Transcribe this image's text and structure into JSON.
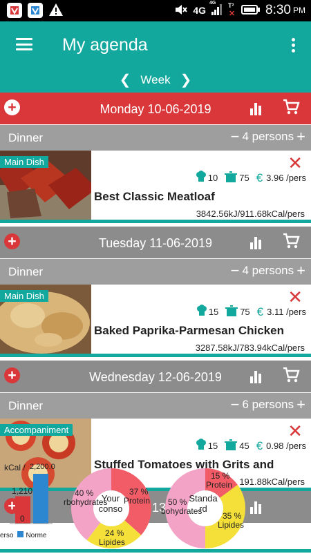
{
  "status_bar": {
    "time": "8:30",
    "ampm": "PM",
    "network": "4G",
    "network_small": "4G",
    "signal_extra": "T²"
  },
  "app_bar": {
    "title": "My agenda",
    "week_label": "Week"
  },
  "days": [
    {
      "date": "Monday 10-06-2019",
      "meal": "Dinner",
      "persons": "4 persons",
      "recipe": {
        "tag": "Main Dish",
        "name": "Best Classic Meatloaf",
        "prep": "10",
        "cook": "75",
        "price": "3.96 /pers",
        "energy": "3842.56kJ/911.68kCal/pers"
      }
    },
    {
      "date": "Tuesday 11-06-2019",
      "meal": "Dinner",
      "persons": "4 persons",
      "recipe": {
        "tag": "Main Dish",
        "name": "Baked Paprika-Parmesan Chicken",
        "prep": "15",
        "cook": "75",
        "price": "3.11 /pers",
        "energy": "3287.58kJ/783.94kCal/pers"
      }
    },
    {
      "date": "Wednesday 12-06-2019",
      "meal": "Dinner",
      "persons": "6 persons",
      "recipe": {
        "tag": "Accompaniment",
        "name": "Stuffed Tomatoes with Grits and",
        "prep": "15",
        "cook": "45",
        "price": "0.98 /pers",
        "energy": "191.88kCal/pers"
      }
    },
    {
      "date_partial": "13"
    }
  ],
  "euro_symbol": "€",
  "overlay": {
    "bar_axis_label": "kCal /",
    "bar_value_top": "2,200.0",
    "bar_left_value": "1,210",
    "bar_zero": "0",
    "legend_left": "erso",
    "legend_right": "Norme",
    "donut1": {
      "center": "Your conso",
      "pct_protein": "37 %",
      "label_protein": "Protein",
      "pct_carbs": "40 %",
      "label_carbs": "rbohydrates",
      "pct_lipids": "24 %",
      "label_lipids": "Lipides"
    },
    "donut2": {
      "center": "Standard",
      "pct_protein": "15 %",
      "label_protein": "Protein",
      "pct_carbs": "50 %",
      "label_carbs": "bohydrates",
      "pct_lipids": "35 %",
      "label_lipids": "Lipides"
    }
  },
  "chart_data": [
    {
      "type": "bar",
      "ylabel": "kCal /",
      "categories": [
        "erso",
        "Norme"
      ],
      "values": [
        1210,
        2200
      ]
    },
    {
      "type": "pie",
      "title": "Your conso",
      "categories": [
        "Protein",
        "rbohydrates",
        "Lipides"
      ],
      "values": [
        37,
        40,
        24
      ]
    },
    {
      "type": "pie",
      "title": "Standard",
      "categories": [
        "Protein",
        "bohydrates",
        "Lipides"
      ],
      "values": [
        15,
        50,
        35
      ]
    }
  ],
  "colors": {
    "teal": "#13a89e",
    "red": "#d9373a",
    "grey": "#8c8c8c",
    "meal_grey": "#9e9e9e",
    "donut_protein": "#f25c66",
    "donut_carbs": "#f3a3c5",
    "donut_lipids": "#f5e03a",
    "bar_blue": "#2c87d0",
    "bar_red": "#d9373a"
  }
}
